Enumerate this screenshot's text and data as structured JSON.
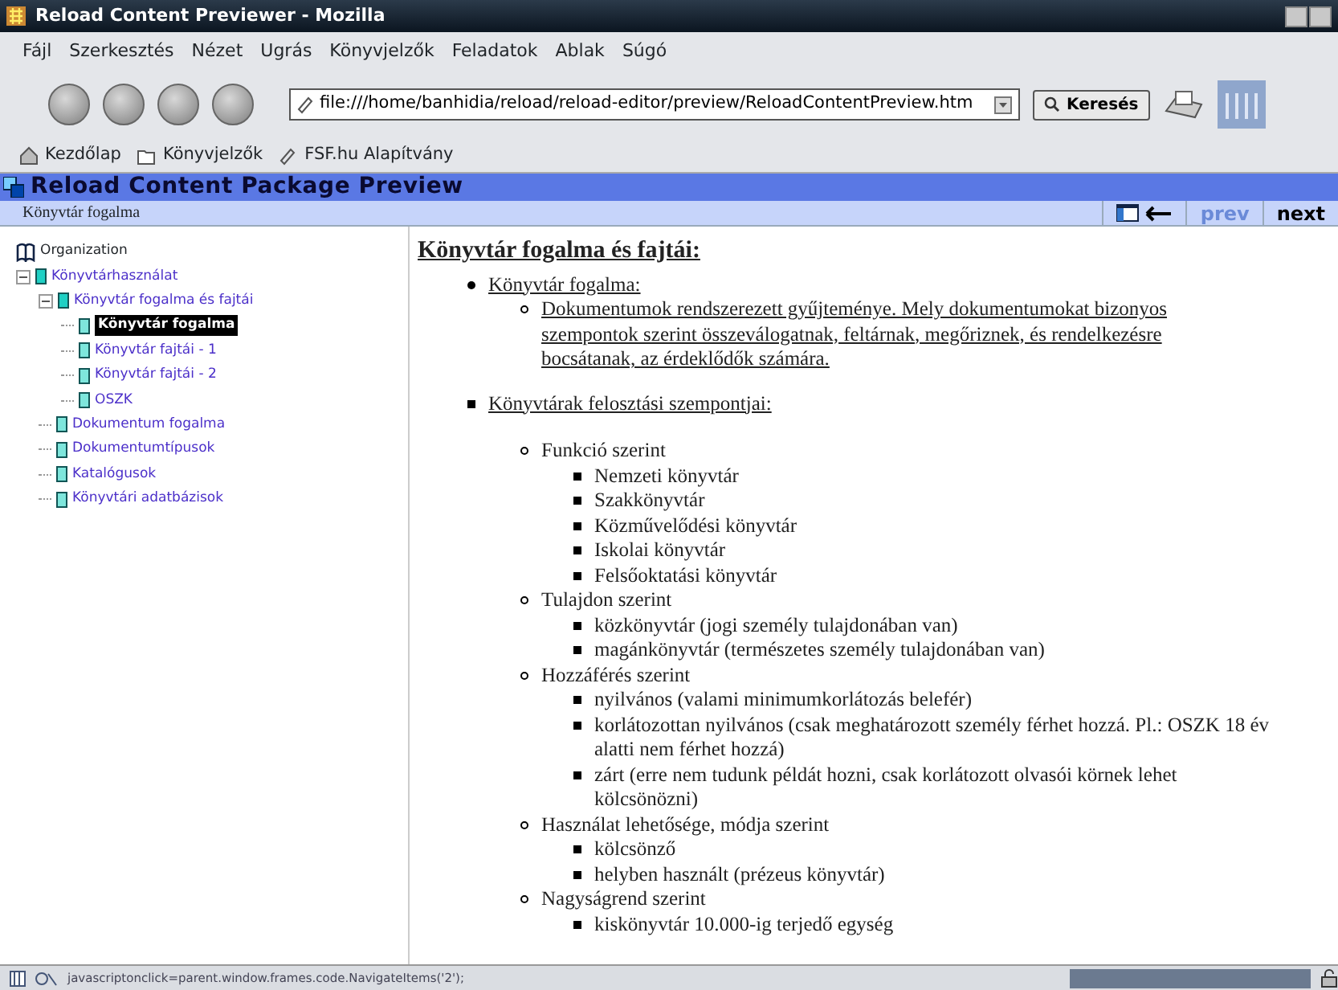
{
  "window": {
    "title": "Reload Content Previewer - Mozilla"
  },
  "menu": [
    "Fájl",
    "Szerkesztés",
    "Nézet",
    "Ugrás",
    "Könyvjelzők",
    "Feladatok",
    "Ablak",
    "Súgó"
  ],
  "toolbar": {
    "url": "file:///home/banhidia/reload/reload-editor/preview/ReloadContentPreview.htm",
    "search_button": "Keresés"
  },
  "bookmarks": [
    "Kezdőlap",
    "Könyvjelzők",
    "FSF.hu Alapítvány"
  ],
  "preview": {
    "title": "Reload Content Package Preview",
    "current": "Könyvtár fogalma",
    "prev": "prev",
    "next": "next"
  },
  "tree": {
    "root": "Organization",
    "items": [
      {
        "label": "Könyvtárhasználat",
        "selected": false,
        "expanded": true,
        "children": [
          {
            "label": "Könyvtár fogalma és fajtái",
            "selected": false,
            "expanded": true,
            "children": [
              {
                "label": "Könyvtár fogalma",
                "selected": true
              },
              {
                "label": "Könyvtár fajtái - 1",
                "selected": false
              },
              {
                "label": "Könyvtár fajtái - 2",
                "selected": false
              },
              {
                "label": "OSZK",
                "selected": false
              }
            ]
          },
          {
            "label": "Dokumentum fogalma",
            "selected": false
          },
          {
            "label": "Dokumentumtípusok",
            "selected": false
          },
          {
            "label": "Katalógusok",
            "selected": false
          },
          {
            "label": "Könyvtári adatbázisok",
            "selected": false
          }
        ]
      }
    ]
  },
  "content": {
    "heading": "Könyvtár fogalma és fajtái:",
    "items": [
      {
        "text": "Könyvtár fogalma:",
        "kind": "disc",
        "link": true,
        "children": [
          {
            "text": "Dokumentumok rendszerezett gyűjteménye. Mely dokumentumokat bizonyos szempontok szerint összeválogatnak, feltárnak, megőriznek, és rendelkezésre bocsátanak, az érdeklődők számára.",
            "kind": "circle",
            "link": true
          }
        ]
      },
      {
        "text": "Könyvtárak felosztási szempontjai:",
        "kind": "square",
        "link": true,
        "children": [
          {
            "text": "Funkció szerint",
            "kind": "circle",
            "link": false,
            "children": [
              {
                "text": "Nemzeti könyvtár",
                "kind": "square",
                "link": false
              },
              {
                "text": "Szakkönyvtár",
                "kind": "square",
                "link": false
              },
              {
                "text": "Közművelődési könyvtár",
                "kind": "square",
                "link": false
              },
              {
                "text": "Iskolai könyvtár",
                "kind": "square",
                "link": false
              },
              {
                "text": "Felsőoktatási könyvtár",
                "kind": "square",
                "link": false
              }
            ]
          },
          {
            "text": "Tulajdon szerint",
            "kind": "circle",
            "link": false,
            "children": [
              {
                "text": "közkönyvtár (jogi személy tulajdonában van)",
                "kind": "square",
                "link": false
              },
              {
                "text": "magánkönyvtár (természetes személy tulajdonában van)",
                "kind": "square",
                "link": false
              }
            ]
          },
          {
            "text": "Hozzáférés szerint",
            "kind": "circle",
            "link": false,
            "children": [
              {
                "text": "nyilvános (valami minimumkorlátozás belefér)",
                "kind": "square",
                "link": false
              },
              {
                "text": "korlátozottan nyilvános (csak meghatározott személy férhet hozzá. Pl.: OSZK 18 év alatti nem férhet hozzá)",
                "kind": "square",
                "link": false
              },
              {
                "text": "zárt (erre nem tudunk példát hozni, csak korlátozott olvasói körnek lehet kölcsönözni)",
                "kind": "square",
                "link": false
              }
            ]
          },
          {
            "text": "Használat lehetősége, módja szerint",
            "kind": "circle",
            "link": false,
            "children": [
              {
                "text": "kölcsönző",
                "kind": "square",
                "link": false
              },
              {
                "text": "helyben használt (prézeus könyvtár)",
                "kind": "square",
                "link": false
              }
            ]
          },
          {
            "text": "Nagyságrend szerint",
            "kind": "circle",
            "link": false,
            "children": [
              {
                "text": "kiskönyvtár 10.000-ig terjedő egység",
                "kind": "square",
                "link": false
              }
            ]
          }
        ]
      }
    ]
  },
  "status_bar": {
    "text": "javascriptonclick=parent.window.frames.code.NavigateItems('2');"
  }
}
